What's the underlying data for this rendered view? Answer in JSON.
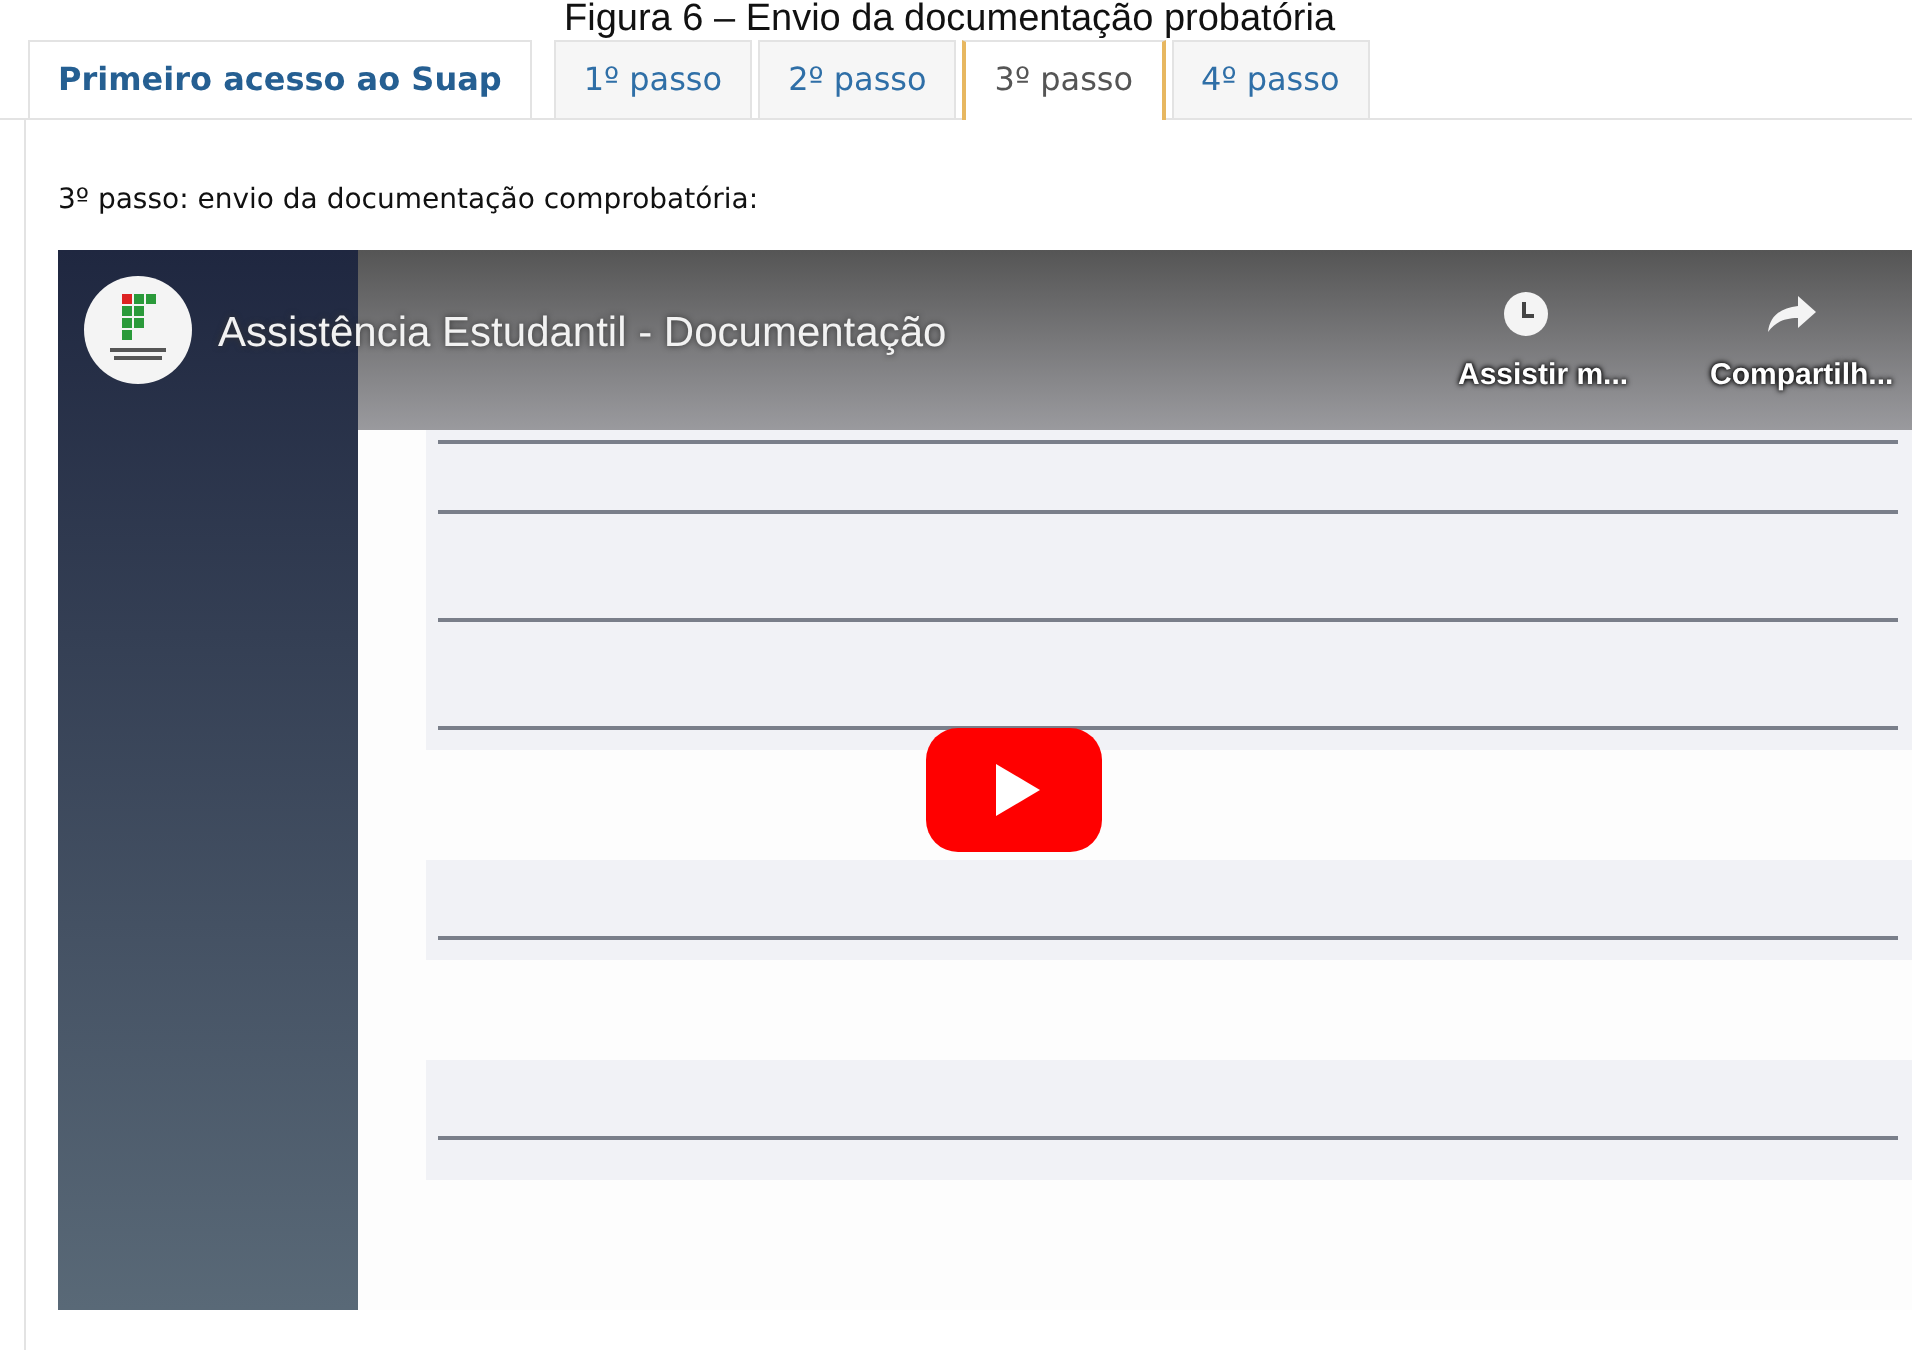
{
  "caption": "Figura 6 – Envio da documentação probatória",
  "tabs": [
    {
      "label": "Primeiro acesso ao Suap",
      "kind": "title",
      "selected": false
    },
    {
      "label": "1º passo",
      "kind": "step",
      "selected": false
    },
    {
      "label": "2º passo",
      "kind": "step",
      "selected": false
    },
    {
      "label": "3º passo",
      "kind": "step",
      "selected": true
    },
    {
      "label": "4º passo",
      "kind": "step",
      "selected": false
    }
  ],
  "heading": "3º passo: envio da documentação comprobatória:",
  "video": {
    "title": "Assistência Estudantil - Documentação",
    "actions": [
      {
        "kind": "clock",
        "label": "Assistir m..."
      },
      {
        "kind": "share",
        "label": "Compartilh..."
      }
    ]
  }
}
